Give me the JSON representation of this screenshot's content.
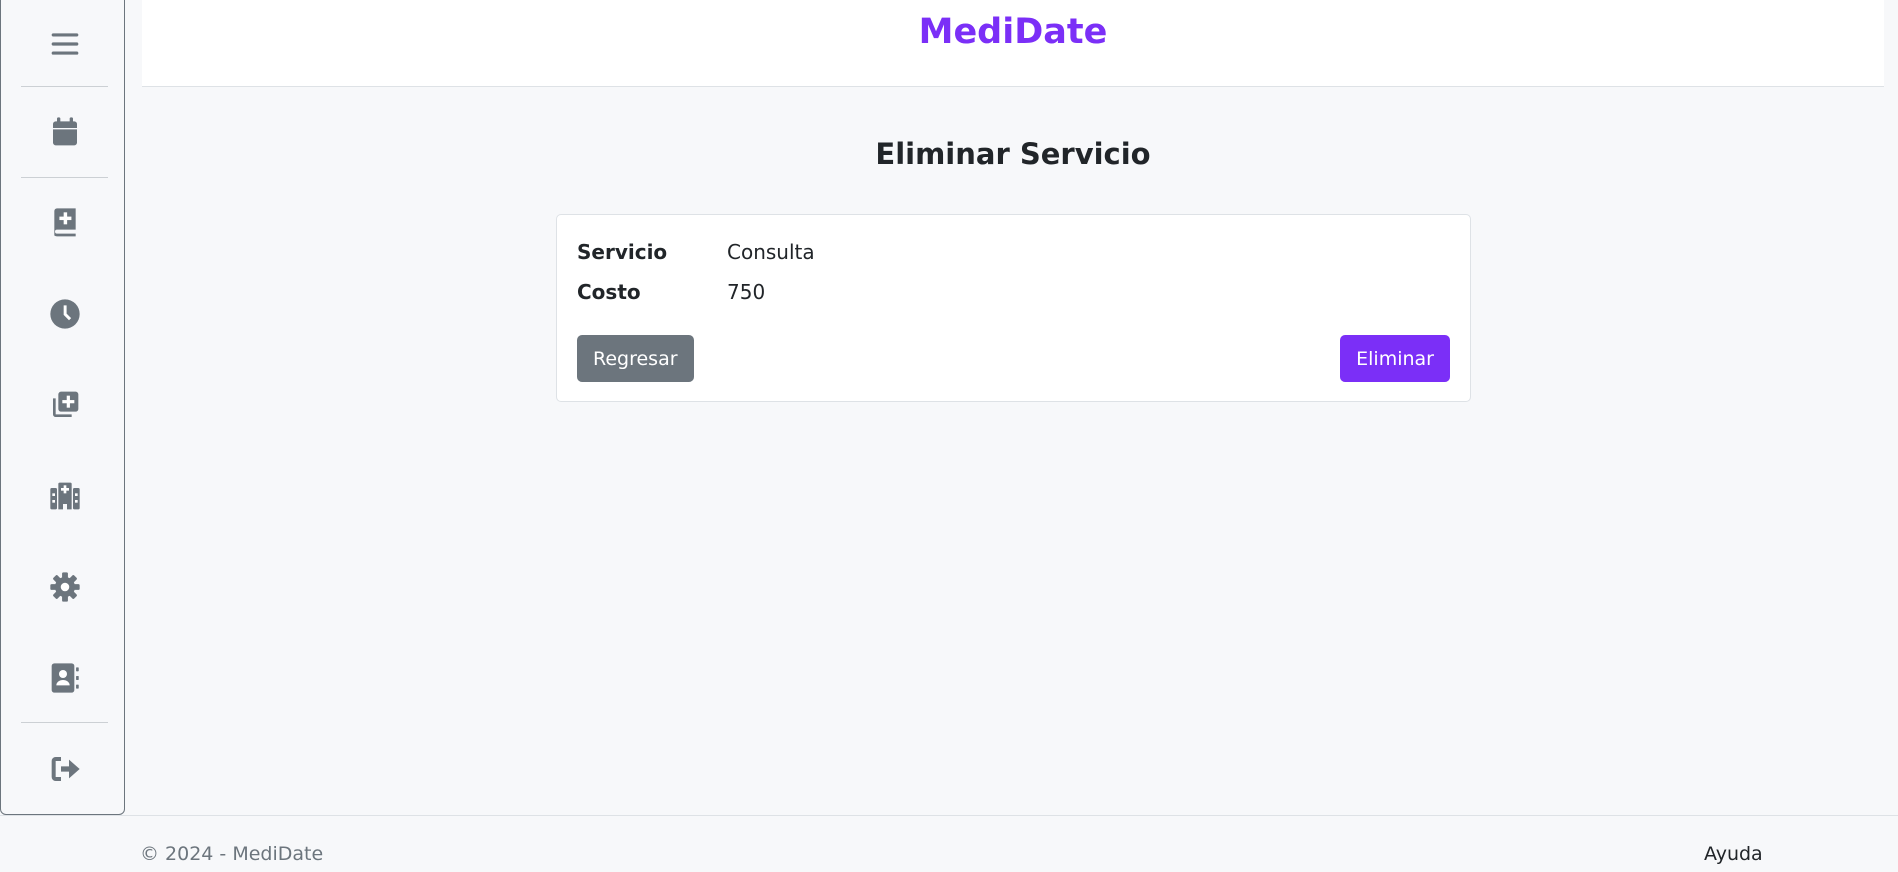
{
  "header": {
    "brand": "MediDate"
  },
  "sidebar": {
    "items": [
      {
        "icon": "menu-icon"
      },
      {
        "icon": "calendar-icon"
      },
      {
        "icon": "medical-book-icon"
      },
      {
        "icon": "clock-icon"
      },
      {
        "icon": "add-copy-icon"
      },
      {
        "icon": "hospital-icon"
      },
      {
        "icon": "gear-icon"
      },
      {
        "icon": "contact-book-icon"
      },
      {
        "icon": "logout-icon"
      }
    ]
  },
  "main": {
    "title": "Eliminar Servicio",
    "details": [
      {
        "label": "Servicio",
        "value": "Consulta"
      },
      {
        "label": "Costo",
        "value": "750"
      }
    ],
    "back_label": "Regresar",
    "delete_label": "Eliminar"
  },
  "footer": {
    "copyright": "© 2024 - MediDate",
    "help": "Ayuda"
  },
  "colors": {
    "accent": "#7b2ff7",
    "secondary": "#6c757d",
    "background": "#f7f8fa"
  }
}
